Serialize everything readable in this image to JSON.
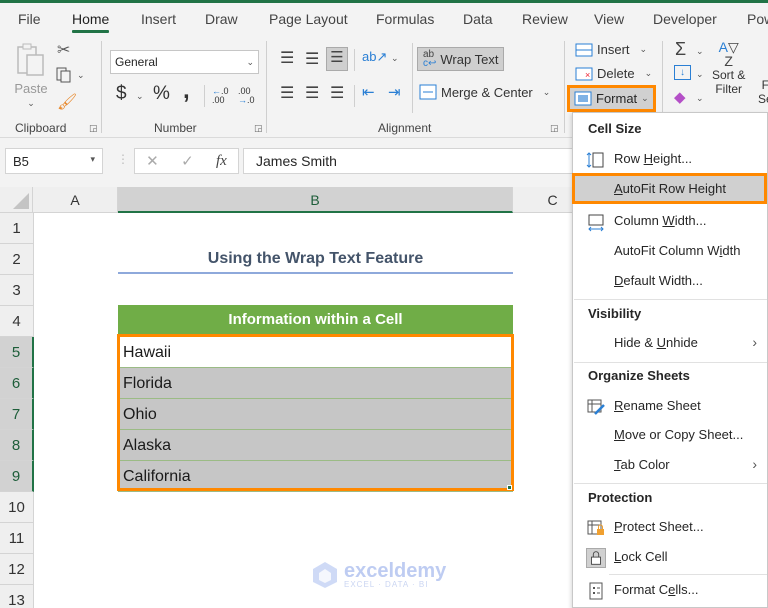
{
  "ribbon_tabs": [
    {
      "label": "File",
      "active": false
    },
    {
      "label": "Home",
      "active": true
    },
    {
      "label": "Insert",
      "active": false
    },
    {
      "label": "Draw",
      "active": false
    },
    {
      "label": "Page Layout",
      "active": false
    },
    {
      "label": "Formulas",
      "active": false
    },
    {
      "label": "Data",
      "active": false
    },
    {
      "label": "Review",
      "active": false
    },
    {
      "label": "View",
      "active": false
    },
    {
      "label": "Developer",
      "active": false
    },
    {
      "label": "Pow",
      "active": false
    }
  ],
  "clipboard": {
    "paste_label": "Paste",
    "group_label": "Clipboard"
  },
  "number": {
    "format_value": "General",
    "group_label": "Number",
    "currency": "$",
    "percent": "%",
    "comma": ","
  },
  "alignment": {
    "wrap_text_label": "Wrap Text",
    "merge_center_label": "Merge & Center",
    "group_label": "Alignment"
  },
  "cells": {
    "insert_label": "Insert",
    "delete_label": "Delete",
    "format_label": "Format"
  },
  "editing": {
    "sum_symbol": "Σ",
    "sort_filter_line1": "Sort &",
    "sort_filter_line2": "Filter",
    "find_line1": "F",
    "find_line2": "Se"
  },
  "formula_bar": {
    "name_box": "B5",
    "cancel_icon": "✕",
    "enter_icon": "✓",
    "fx_label": "fx",
    "value": "James Smith"
  },
  "columns": [
    "A",
    "B",
    "C"
  ],
  "selected_column": "B",
  "rows": [
    "1",
    "2",
    "3",
    "4",
    "5",
    "6",
    "7",
    "8",
    "9",
    "10",
    "11",
    "12",
    "13"
  ],
  "sheet": {
    "title": "Using the Wrap Text Feature",
    "header": "Information within a Cell",
    "data": [
      "Hawaii",
      "Florida",
      "Ohio",
      "Alaska",
      "California"
    ]
  },
  "colors": {
    "excel_green": "#217346",
    "table_header_green": "#70ad47",
    "highlight_orange": "#ff8800",
    "title_text": "#44546a"
  },
  "format_menu": {
    "sections": [
      {
        "heading": "Cell Size",
        "items": [
          {
            "label": "Row Height...",
            "icon": "row-height-icon",
            "underline": "H"
          },
          {
            "label": "AutoFit Row Height",
            "highlighted": true,
            "underline": "A"
          },
          {
            "label": "Column Width...",
            "icon": "column-width-icon",
            "underline": "W"
          },
          {
            "label": "AutoFit Column Width",
            "underline": "I"
          },
          {
            "label": "Default Width...",
            "underline": "D"
          }
        ]
      },
      {
        "heading": "Visibility",
        "items": [
          {
            "label": "Hide & Unhide",
            "submenu": true,
            "underline": "U"
          }
        ]
      },
      {
        "heading": "Organize Sheets",
        "items": [
          {
            "label": "Rename Sheet",
            "icon": "rename-sheet-icon",
            "underline": "R"
          },
          {
            "label": "Move or Copy Sheet...",
            "underline": "M"
          },
          {
            "label": "Tab Color",
            "submenu": true,
            "underline": "T"
          }
        ]
      },
      {
        "heading": "Protection",
        "items": [
          {
            "label": "Protect Sheet...",
            "icon": "protect-sheet-icon",
            "underline": "P"
          },
          {
            "label": "Lock Cell",
            "icon": "lock-icon",
            "underline": "L"
          },
          {
            "label": "Format Cells...",
            "icon": "format-cells-icon",
            "underline": "E"
          }
        ]
      }
    ]
  },
  "watermark": {
    "name": "exceldemy",
    "tagline": "EXCEL · DATA · BI"
  }
}
